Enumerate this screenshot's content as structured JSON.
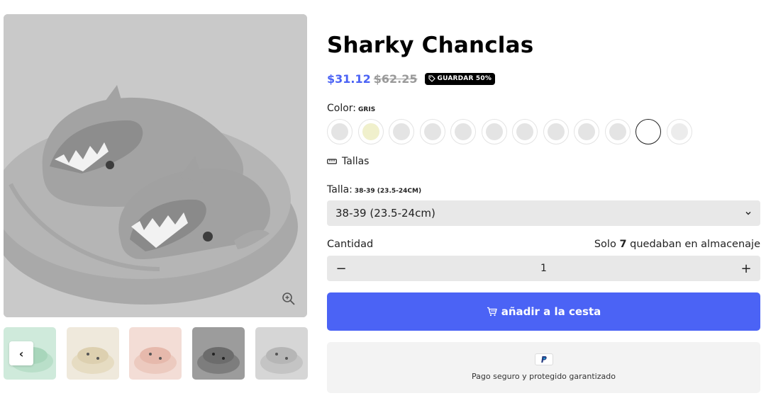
{
  "product": {
    "title": "Sharky Chanclas",
    "price_sale": "$31.12",
    "price_compare": "$62.25",
    "badge": "GUARDAR 50%"
  },
  "color": {
    "label": "Color:",
    "selected": "GRIS",
    "swatches": [
      {
        "hex": "#e4e4e4"
      },
      {
        "hex": "#f0f0cc"
      },
      {
        "hex": "#e4e4e4"
      },
      {
        "hex": "#e4e4e4"
      },
      {
        "hex": "#e4e4e4"
      },
      {
        "hex": "#e4e4e4"
      },
      {
        "hex": "#e4e4e4"
      },
      {
        "hex": "#e4e4e4"
      },
      {
        "hex": "#e4e4e4"
      },
      {
        "hex": "#e4e4e4"
      },
      {
        "hex": "#ffffff",
        "selected": true
      },
      {
        "hex": "#ececec"
      }
    ]
  },
  "size_guide": {
    "label": "Tallas",
    "icon": "ruler-icon"
  },
  "size": {
    "label": "Talla:",
    "selected": "38-39 (23.5-24CM)",
    "value": "38-39 (23.5-24cm)"
  },
  "quantity": {
    "label": "Cantidad",
    "stock_prefix": "Solo",
    "stock_count": "7",
    "stock_suffix": "quedaban en almacenaje",
    "value": "1",
    "minus": "−",
    "plus": "+"
  },
  "add_to_cart": {
    "label": "añadir a la cesta",
    "icon": "cart-icon"
  },
  "trust": {
    "text": "Pago seguro y protegido garantizado",
    "icon": "paypal-icon"
  },
  "gallery": {
    "prev": "‹",
    "thumbs": [
      {
        "bg": "#cfeadb",
        "color": "#b9dfc9"
      },
      {
        "bg": "#efe9dc",
        "color": "#e6dcc2"
      },
      {
        "bg": "#f3ddd6",
        "color": "#eccabf"
      },
      {
        "bg": "#9c9c9c",
        "color": "#7d7d7d"
      },
      {
        "bg": "#d6d6d6",
        "color": "#c4c4c4"
      }
    ]
  },
  "colors": {
    "accent": "#4b63f5",
    "badge": "#000000",
    "field": "#e8e8e8"
  }
}
